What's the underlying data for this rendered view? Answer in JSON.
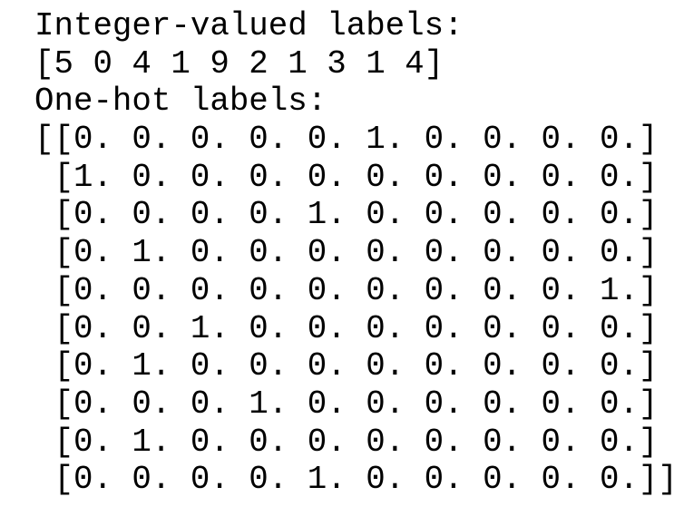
{
  "output": {
    "integer_heading": "Integer-valued labels:",
    "integer_labels": "[5 0 4 1 9 2 1 3 1 4]",
    "onehot_heading": "One-hot labels:",
    "onehot_rows": [
      "[[0. 0. 0. 0. 0. 1. 0. 0. 0. 0.]",
      " [1. 0. 0. 0. 0. 0. 0. 0. 0. 0.]",
      " [0. 0. 0. 0. 1. 0. 0. 0. 0. 0.]",
      " [0. 1. 0. 0. 0. 0. 0. 0. 0. 0.]",
      " [0. 0. 0. 0. 0. 0. 0. 0. 0. 1.]",
      " [0. 0. 1. 0. 0. 0. 0. 0. 0. 0.]",
      " [0. 1. 0. 0. 0. 0. 0. 0. 0. 0.]",
      " [0. 0. 0. 1. 0. 0. 0. 0. 0. 0.]",
      " [0. 1. 0. 0. 0. 0. 0. 0. 0. 0.]",
      " [0. 0. 0. 0. 1. 0. 0. 0. 0. 0.]]"
    ]
  }
}
